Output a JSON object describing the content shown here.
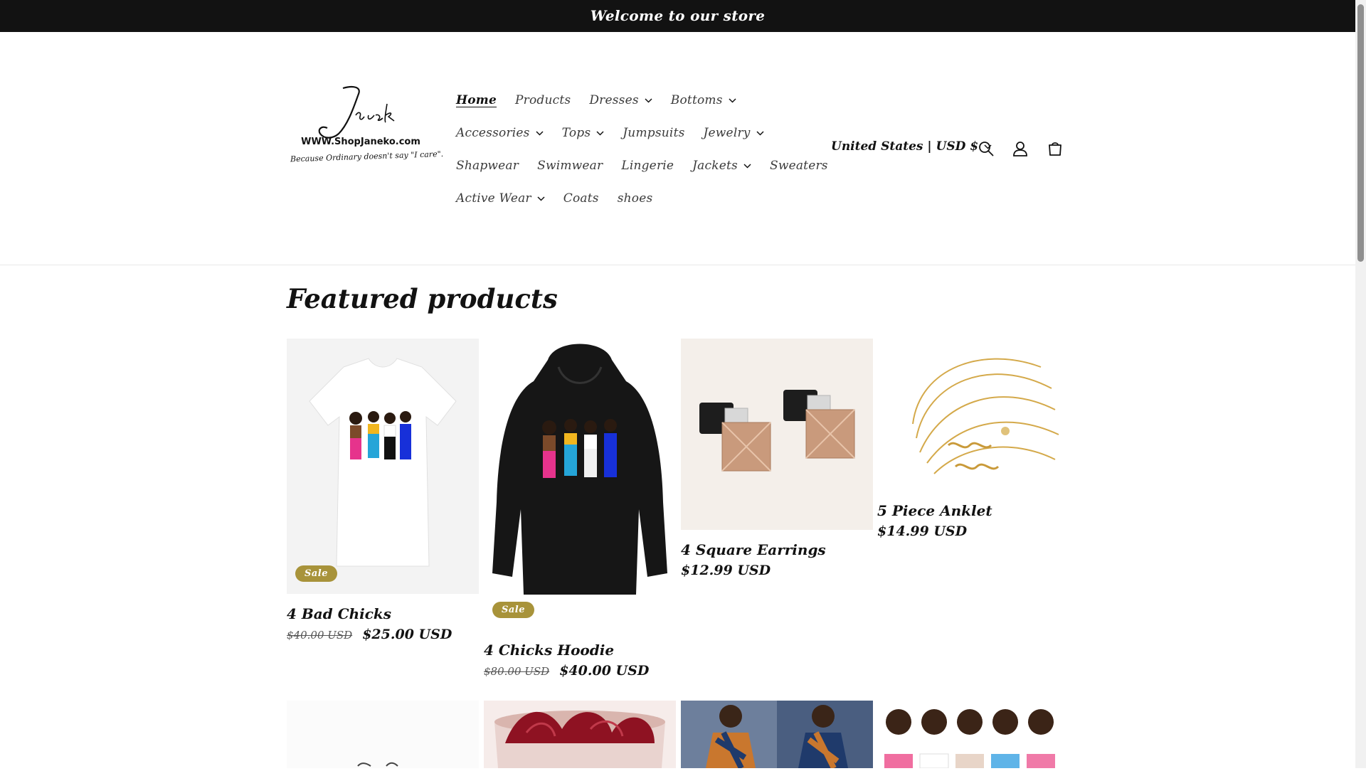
{
  "announcement": "Welcome to our store",
  "logo": {
    "name": "Janeko",
    "url": "WWW.ShopJaneko.com",
    "tagline": "Because Ordinary doesn't say \"I care\"."
  },
  "nav": {
    "rows": [
      [
        {
          "label": "Home",
          "dropdown": false,
          "active": true
        },
        {
          "label": "Products",
          "dropdown": false
        },
        {
          "label": "Dresses",
          "dropdown": true
        },
        {
          "label": "Bottoms",
          "dropdown": true
        }
      ],
      [
        {
          "label": "Accessories",
          "dropdown": true
        },
        {
          "label": "Tops",
          "dropdown": true
        },
        {
          "label": "Jumpsuits",
          "dropdown": false
        },
        {
          "label": "Jewelry",
          "dropdown": true
        }
      ],
      [
        {
          "label": "Shapwear",
          "dropdown": false
        },
        {
          "label": "Swimwear",
          "dropdown": false
        },
        {
          "label": "Lingerie",
          "dropdown": false
        },
        {
          "label": "Jackets",
          "dropdown": true
        },
        {
          "label": "Sweaters",
          "dropdown": false
        }
      ],
      [
        {
          "label": "Active Wear",
          "dropdown": true
        },
        {
          "label": "Coats",
          "dropdown": false
        },
        {
          "label": "shoes",
          "dropdown": false
        }
      ]
    ]
  },
  "header": {
    "locale": "United States | USD $",
    "icons": [
      "search-icon",
      "account-icon",
      "cart-icon"
    ]
  },
  "featured": {
    "title": "Featured products",
    "products": [
      {
        "title": "4 Bad Chicks",
        "sale": true,
        "sale_label": "Sale",
        "old_price": "$40.00 USD",
        "price": "$25.00 USD"
      },
      {
        "title": "4 Chicks Hoodie",
        "sale": true,
        "sale_label": "Sale",
        "old_price": "$80.00 USD",
        "price": "$40.00 USD"
      },
      {
        "title": "4 Square Earrings",
        "sale": false,
        "price": "$12.99 USD"
      },
      {
        "title": "5 Piece Anklet",
        "sale": false,
        "price": "$14.99 USD"
      }
    ]
  },
  "colors": {
    "announcement_bg": "#121212",
    "sale_badge": "#a8933a",
    "text": "#121212"
  }
}
